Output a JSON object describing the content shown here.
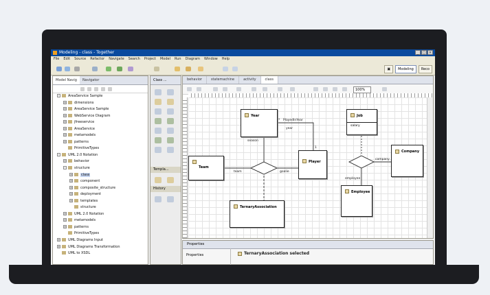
{
  "window": {
    "title": "Modeling - class - Together"
  },
  "menu": [
    "File",
    "Edit",
    "Source",
    "Refactor",
    "Navigate",
    "Search",
    "Project",
    "Model",
    "Run",
    "Diagram",
    "Window",
    "Help"
  ],
  "perspectives": [
    {
      "label": "Modeling",
      "active": true
    },
    {
      "label": "Reco",
      "active": false
    }
  ],
  "left_panel": {
    "tabs": [
      "Model Navig",
      "Navigator"
    ],
    "tree": [
      {
        "label": "AreaService Sample",
        "depth": 0,
        "exp": "-"
      },
      {
        "label": "dimensions",
        "depth": 1,
        "exp": "+"
      },
      {
        "label": "AreaService Sample",
        "depth": 1,
        "exp": "+"
      },
      {
        "label": "WebService Diagram",
        "depth": 1,
        "exp": "+"
      },
      {
        "label": "jfreeservice",
        "depth": 1,
        "exp": "+"
      },
      {
        "label": "AreaService",
        "depth": 1,
        "exp": "+"
      },
      {
        "label": "metamodels",
        "depth": 1,
        "exp": "+"
      },
      {
        "label": "patterns",
        "depth": 1,
        "exp": "+"
      },
      {
        "label": "PrimitiveTypes",
        "depth": 1,
        "exp": ""
      },
      {
        "label": "UML 2.0 Notation",
        "depth": 0,
        "exp": "-"
      },
      {
        "label": "behavior",
        "depth": 1,
        "exp": "+"
      },
      {
        "label": "structure",
        "depth": 1,
        "exp": "-"
      },
      {
        "label": "class",
        "depth": 2,
        "exp": "+",
        "selected": true
      },
      {
        "label": "component",
        "depth": 2,
        "exp": "+"
      },
      {
        "label": "composite_structure",
        "depth": 2,
        "exp": "+"
      },
      {
        "label": "deployment",
        "depth": 2,
        "exp": "+"
      },
      {
        "label": "templates",
        "depth": 2,
        "exp": "+"
      },
      {
        "label": "structure",
        "depth": 2,
        "exp": ""
      },
      {
        "label": "UML 2.0 Notation",
        "depth": 1,
        "exp": "+"
      },
      {
        "label": "metamodels",
        "depth": 1,
        "exp": "+"
      },
      {
        "label": "patterns",
        "depth": 1,
        "exp": "+"
      },
      {
        "label": "PrimitiveTypes",
        "depth": 1,
        "exp": ""
      },
      {
        "label": "UML Diagrams Input",
        "depth": 0,
        "exp": "+"
      },
      {
        "label": "UML Diagrams Transformation",
        "depth": 0,
        "exp": "+"
      },
      {
        "label": "UML to XSDL",
        "depth": 0,
        "exp": ""
      }
    ]
  },
  "palette": {
    "tab": "Class ...",
    "sections": [
      "Templa...",
      "History"
    ]
  },
  "editor": {
    "tabs": [
      {
        "label": "behavior",
        "active": false
      },
      {
        "label": "statemachine",
        "active": false
      },
      {
        "label": "activity",
        "active": false
      },
      {
        "label": "class",
        "active": true
      }
    ],
    "zoom": "100%",
    "diagram": {
      "classes": [
        "Year",
        "Team",
        "Player",
        "Job",
        "Company",
        "Employee",
        "TernaryAssociation"
      ],
      "job_attribute": "salary",
      "labels": {
        "played_in_year": "PlayedInYear",
        "year": "year",
        "season": "season",
        "team": "team",
        "goalie": "goalie",
        "company": "company",
        "employee": "employee",
        "multiplicity": "1",
        "marker": "*"
      }
    }
  },
  "properties": {
    "tab": "Properties",
    "side_label": "Properties",
    "selection": "TernaryAssociation selected"
  }
}
